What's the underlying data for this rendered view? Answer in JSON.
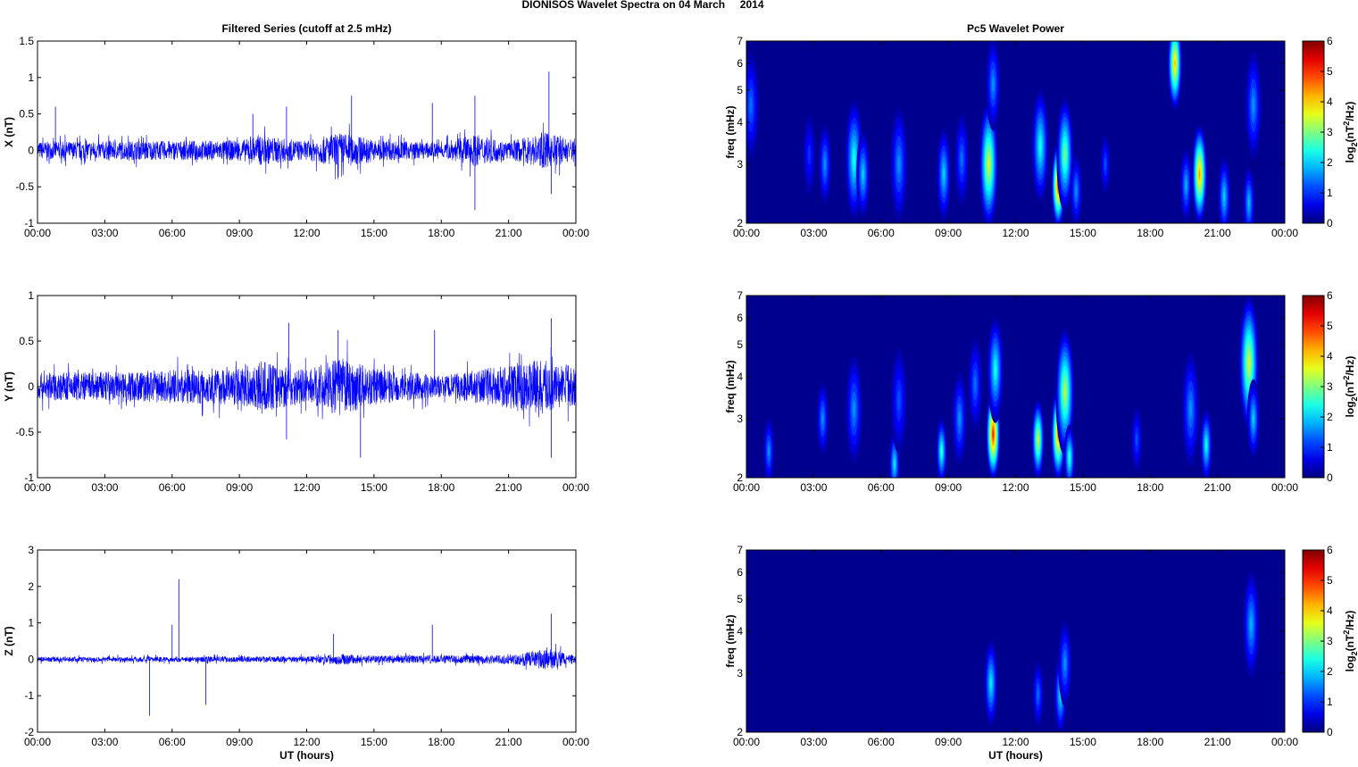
{
  "figure_title": "DIONISOS Wavelet Spectra on 04 March     2014",
  "colors": {
    "trace": "#0000ff",
    "spec_background": "#00008f"
  },
  "chart_data": [
    {
      "id": "x-series",
      "type": "line",
      "title": "Filtered Series (cutoff at 2.5 mHz)",
      "ylabel": "X (nT)",
      "xlabel": "",
      "xlim": [
        0,
        24
      ],
      "ylim": [
        -1,
        1.5
      ],
      "yticks": [
        "-1",
        "-0.5",
        "0",
        "0.5",
        "1",
        "1.5"
      ],
      "ytick_values": [
        -1,
        -0.5,
        0,
        0.5,
        1,
        1.5
      ],
      "xticks": [
        "00:00",
        "03:00",
        "06:00",
        "09:00",
        "12:00",
        "15:00",
        "18:00",
        "21:00",
        "00:00"
      ],
      "noise_amplitude": [
        [
          0,
          0.12
        ],
        [
          9,
          0.14
        ],
        [
          10,
          0.2
        ],
        [
          12,
          0.13
        ],
        [
          13.5,
          0.25
        ],
        [
          15,
          0.15
        ],
        [
          18,
          0.1
        ],
        [
          19.5,
          0.22
        ],
        [
          21,
          0.12
        ],
        [
          22.5,
          0.25
        ],
        [
          24,
          0.15
        ]
      ],
      "spikes": [
        [
          0.8,
          0.6
        ],
        [
          9.6,
          0.5
        ],
        [
          11.1,
          0.6
        ],
        [
          14.0,
          0.75
        ],
        [
          17.6,
          0.65
        ],
        [
          19.5,
          -0.82
        ],
        [
          19.5,
          0.75
        ],
        [
          22.8,
          1.08
        ],
        [
          22.9,
          -0.6
        ]
      ]
    },
    {
      "id": "y-series",
      "type": "line",
      "title": "",
      "ylabel": "Y (nT)",
      "xlabel": "",
      "xlim": [
        0,
        24
      ],
      "ylim": [
        -1,
        1
      ],
      "yticks": [
        "-1",
        "-0.5",
        "0",
        "0.5",
        "1"
      ],
      "ytick_values": [
        -1,
        -0.5,
        0,
        0.5,
        1
      ],
      "xticks": [
        "00:00",
        "03:00",
        "06:00",
        "09:00",
        "12:00",
        "15:00",
        "18:00",
        "21:00",
        "00:00"
      ],
      "noise_amplitude": [
        [
          0,
          0.15
        ],
        [
          9,
          0.2
        ],
        [
          10,
          0.28
        ],
        [
          12,
          0.18
        ],
        [
          13.5,
          0.32
        ],
        [
          15,
          0.2
        ],
        [
          18,
          0.12
        ],
        [
          20,
          0.2
        ],
        [
          22.5,
          0.3
        ],
        [
          24,
          0.2
        ]
      ],
      "spikes": [
        [
          11.2,
          0.7
        ],
        [
          11.1,
          -0.58
        ],
        [
          13.4,
          0.62
        ],
        [
          14.4,
          -0.78
        ],
        [
          17.7,
          0.62
        ],
        [
          22.9,
          0.75
        ],
        [
          22.9,
          -0.78
        ]
      ]
    },
    {
      "id": "z-series",
      "type": "line",
      "title": "",
      "ylabel": "Z (nT)",
      "xlabel": "UT (hours)",
      "xlim": [
        0,
        24
      ],
      "ylim": [
        -2,
        3
      ],
      "yticks": [
        "-2",
        "-1",
        "0",
        "1",
        "2",
        "3"
      ],
      "ytick_values": [
        -2,
        -1,
        0,
        1,
        2,
        3
      ],
      "xticks": [
        "00:00",
        "03:00",
        "06:00",
        "09:00",
        "12:00",
        "15:00",
        "18:00",
        "21:00",
        "00:00"
      ],
      "noise_amplitude": [
        [
          0,
          0.07
        ],
        [
          12,
          0.08
        ],
        [
          13.5,
          0.15
        ],
        [
          15,
          0.1
        ],
        [
          21,
          0.12
        ],
        [
          22.8,
          0.3
        ],
        [
          24,
          0.1
        ]
      ],
      "spikes": [
        [
          5.0,
          -1.55
        ],
        [
          6.0,
          0.95
        ],
        [
          6.3,
          2.2
        ],
        [
          7.5,
          -1.25
        ],
        [
          13.2,
          0.7
        ],
        [
          17.6,
          0.95
        ],
        [
          22.9,
          1.25
        ]
      ]
    },
    {
      "id": "x-spectrum",
      "type": "heatmap",
      "title": "Pc5 Wavelet Power",
      "ylabel": "freq (mHz)",
      "xlabel": "",
      "xlim": [
        0,
        24
      ],
      "ylim": [
        2,
        7
      ],
      "yscale": "log",
      "yticks": [
        "2",
        "3",
        "4",
        "5",
        "6",
        "7"
      ],
      "ytick_values": [
        2,
        3,
        4,
        5,
        6,
        7
      ],
      "xticks": [
        "00:00",
        "03:00",
        "06:00",
        "09:00",
        "12:00",
        "15:00",
        "18:00",
        "21:00",
        "00:00"
      ],
      "colorbar": {
        "label_prefix": "log",
        "label_sub": "2",
        "label_mid": "(nT",
        "label_sup": "2",
        "label_suffix": "/Hz)",
        "range": [
          0,
          6
        ],
        "ticks": [
          "0",
          "1",
          "2",
          "3",
          "4",
          "5",
          "6"
        ]
      },
      "power_peaks": [
        [
          0.2,
          4.5,
          1.4,
          1.2
        ],
        [
          2.8,
          3.2,
          1.0,
          0.8
        ],
        [
          3.5,
          3,
          1.6,
          0.8
        ],
        [
          4.8,
          3.1,
          2.4,
          1.4
        ],
        [
          5.2,
          2.8,
          2.0,
          0.9
        ],
        [
          6.8,
          3,
          1.6,
          1.3
        ],
        [
          8.8,
          2.8,
          2.0,
          1.0
        ],
        [
          9.6,
          3.1,
          1.4,
          1.0
        ],
        [
          10.8,
          3,
          3.6,
          1.5
        ],
        [
          11.0,
          5.2,
          1.6,
          1.0
        ],
        [
          13.1,
          3.4,
          2.4,
          1.3
        ],
        [
          13.9,
          2.6,
          5.0,
          0.9
        ],
        [
          14.2,
          3.2,
          3.0,
          1.3
        ],
        [
          14.7,
          2.5,
          1.6,
          0.7
        ],
        [
          16.0,
          3,
          1.2,
          0.5
        ],
        [
          19.1,
          6,
          4.2,
          1.0
        ],
        [
          19.6,
          2.6,
          1.8,
          0.7
        ],
        [
          20.2,
          2.8,
          4.4,
          1.1
        ],
        [
          21.3,
          2.4,
          2.0,
          0.8
        ],
        [
          22.4,
          2.3,
          1.9,
          0.7
        ],
        [
          22.6,
          4.5,
          1.6,
          1.2
        ]
      ]
    },
    {
      "id": "y-spectrum",
      "type": "heatmap",
      "title": "",
      "ylabel": "freq (mHz)",
      "xlabel": "",
      "xlim": [
        0,
        24
      ],
      "ylim": [
        2,
        7
      ],
      "yscale": "log",
      "yticks": [
        "2",
        "3",
        "4",
        "5",
        "6",
        "7"
      ],
      "ytick_values": [
        2,
        3,
        4,
        5,
        6,
        7
      ],
      "xticks": [
        "00:00",
        "03:00",
        "06:00",
        "09:00",
        "12:00",
        "15:00",
        "18:00",
        "21:00",
        "00:00"
      ],
      "colorbar": {
        "label_prefix": "log",
        "label_sub": "2",
        "label_mid": "(nT",
        "label_sup": "2",
        "label_suffix": "/Hz)",
        "range": [
          0,
          6
        ],
        "ticks": [
          "0",
          "1",
          "2",
          "3",
          "4",
          "5",
          "6"
        ]
      },
      "power_peaks": [
        [
          1.0,
          2.4,
          1.6,
          0.6
        ],
        [
          3.4,
          3,
          1.6,
          0.7
        ],
        [
          4.8,
          3.2,
          1.6,
          1.2
        ],
        [
          6.6,
          2.2,
          2.2,
          0.6
        ],
        [
          6.8,
          3.4,
          1.2,
          1.2
        ],
        [
          8.7,
          2.4,
          2.6,
          0.6
        ],
        [
          9.5,
          3,
          1.6,
          1.0
        ],
        [
          10.2,
          3.8,
          1.4,
          1.0
        ],
        [
          11.0,
          2.7,
          5.2,
          1.0
        ],
        [
          11.1,
          4.2,
          2.4,
          1.2
        ],
        [
          13.0,
          2.6,
          3.6,
          0.8
        ],
        [
          13.9,
          2.7,
          4.6,
          1.0
        ],
        [
          14.2,
          3.6,
          3.4,
          1.5
        ],
        [
          14.4,
          2.3,
          2.6,
          0.6
        ],
        [
          17.4,
          2.6,
          1.2,
          0.6
        ],
        [
          19.8,
          3.2,
          1.6,
          1.3
        ],
        [
          20.5,
          2.5,
          2.4,
          0.7
        ],
        [
          22.4,
          4.4,
          3.6,
          1.6
        ],
        [
          22.6,
          3,
          2.0,
          0.8
        ]
      ]
    },
    {
      "id": "z-spectrum",
      "type": "heatmap",
      "title": "",
      "ylabel": "freq (mHz)",
      "xlabel": "UT (hours)",
      "xlim": [
        0,
        24
      ],
      "ylim": [
        2,
        7
      ],
      "yscale": "log",
      "yticks": [
        "2",
        "3",
        "4",
        "5",
        "6",
        "7"
      ],
      "ytick_values": [
        2,
        3,
        4,
        5,
        6,
        7
      ],
      "xticks": [
        "00:00",
        "03:00",
        "06:00",
        "09:00",
        "12:00",
        "15:00",
        "18:00",
        "21:00",
        "00:00"
      ],
      "colorbar": {
        "label_prefix": "log",
        "label_sub": "2",
        "label_mid": "(nT",
        "label_sup": "2",
        "label_suffix": "/Hz)",
        "range": [
          0,
          6
        ],
        "ticks": [
          "0",
          "1",
          "2",
          "3",
          "4",
          "5",
          "6"
        ]
      },
      "power_peaks": [
        [
          10.9,
          2.8,
          2.2,
          0.9
        ],
        [
          13.0,
          2.6,
          1.4,
          0.6
        ],
        [
          14.0,
          2.6,
          2.2,
          0.8
        ],
        [
          14.2,
          3.2,
          1.6,
          0.9
        ],
        [
          22.5,
          4.2,
          1.8,
          1.2
        ]
      ]
    }
  ]
}
